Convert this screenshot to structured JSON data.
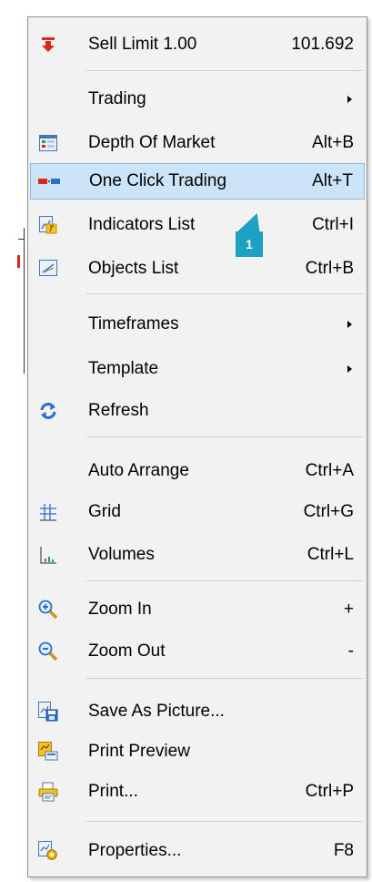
{
  "menu": {
    "items": [
      {
        "label": "Sell Limit 1.00",
        "shortcut": "101.692",
        "icon": "sell-arrow-icon"
      },
      {
        "label": "Trading",
        "submenu": true
      },
      {
        "label": "Depth Of Market",
        "shortcut": "Alt+B",
        "icon": "depth-of-market-icon"
      },
      {
        "label": "One Click Trading",
        "shortcut": "Alt+T",
        "icon": "one-click-trading-icon",
        "selected": true
      },
      {
        "label": "Indicators List",
        "shortcut": "Ctrl+I",
        "icon": "indicators-list-icon"
      },
      {
        "label": "Objects List",
        "shortcut": "Ctrl+B",
        "icon": "objects-list-icon"
      },
      {
        "label": "Timeframes",
        "submenu": true
      },
      {
        "label": "Template",
        "submenu": true
      },
      {
        "label": "Refresh",
        "icon": "refresh-icon"
      },
      {
        "label": "Auto Arrange",
        "shortcut": "Ctrl+A"
      },
      {
        "label": "Grid",
        "shortcut": "Ctrl+G",
        "icon": "grid-icon"
      },
      {
        "label": "Volumes",
        "shortcut": "Ctrl+L",
        "icon": "volumes-icon"
      },
      {
        "label": "Zoom In",
        "shortcut": "+",
        "icon": "zoom-in-icon"
      },
      {
        "label": "Zoom Out",
        "shortcut": "-",
        "icon": "zoom-out-icon"
      },
      {
        "label": "Save As Picture...",
        "icon": "save-as-picture-icon"
      },
      {
        "label": "Print Preview",
        "icon": "print-preview-icon"
      },
      {
        "label": "Print...",
        "shortcut": "Ctrl+P",
        "icon": "printer-icon"
      },
      {
        "label": "Properties...",
        "shortcut": "F8",
        "icon": "properties-icon"
      }
    ]
  },
  "annotation": {
    "badge_number": "1"
  },
  "colors": {
    "selection": "#cce4f7",
    "badge": "#1da1c3"
  }
}
